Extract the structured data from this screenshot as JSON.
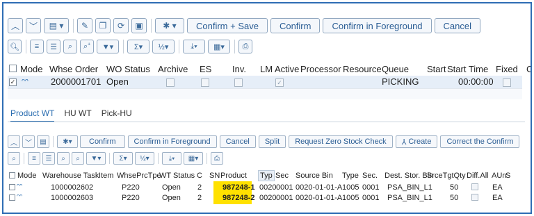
{
  "top": {
    "toolbar": {
      "confirm_save": "Confirm + Save",
      "confirm": "Confirm",
      "confirm_foreground": "Confirm in Foreground",
      "cancel": "Cancel"
    },
    "columns": [
      "Mode",
      "Whse Order",
      "WO Status",
      "Archive",
      "ES",
      "Inv.",
      "LM Active",
      "Processor",
      "Resource",
      "Queue",
      "Start",
      "Start Time",
      "Fixed",
      "C"
    ],
    "row": {
      "whse_order": "2000001701",
      "wo_status": "Open",
      "queue": "PICKING",
      "start_time": "00:00:00"
    }
  },
  "tabs": [
    "Product WT",
    "HU WT",
    "Pick-HU"
  ],
  "bottom": {
    "toolbar": {
      "confirm": "Confirm",
      "confirm_foreground": "Confirm in Foreground",
      "cancel": "Cancel",
      "split": "Split",
      "zero_stock": "Request Zero Stock Check",
      "create": "Create",
      "correct": "Correct the Confirm"
    },
    "columns": [
      "Mode",
      "Warehouse Task",
      "Item",
      "WhsePrcTpe",
      "WT Status",
      "C",
      "SN",
      "Product",
      "Typ",
      "Sec",
      "Source Bin",
      "Type",
      "Sec.",
      "Dest. Stor. Bin",
      "SrceTgtQty",
      "Diff.All",
      "AUn",
      "S"
    ],
    "rows": [
      {
        "task": "1000002602",
        "prc": "P220",
        "status": "Open",
        "c": "2",
        "product": "987248-1",
        "typ": "0020",
        "sec": "0001",
        "source_bin": "0020-01-01-A",
        "type": "1005",
        "sec2": "0001",
        "dest": "PSA_BIN_L1",
        "qty": "50",
        "aun": "EA"
      },
      {
        "task": "1000002603",
        "prc": "P220",
        "status": "Open",
        "c": "2",
        "product": "987248-2",
        "typ": "0020",
        "sec": "0001",
        "source_bin": "0020-01-01-A",
        "type": "1005",
        "sec2": "0001",
        "dest": "PSA_BIN_L1",
        "qty": "50",
        "aun": "EA"
      }
    ]
  },
  "colors": {
    "frame": "#2e6db4",
    "highlight": "#ffe100",
    "selected_row": "#e6eef8",
    "active_tab": "#2a6db0"
  }
}
